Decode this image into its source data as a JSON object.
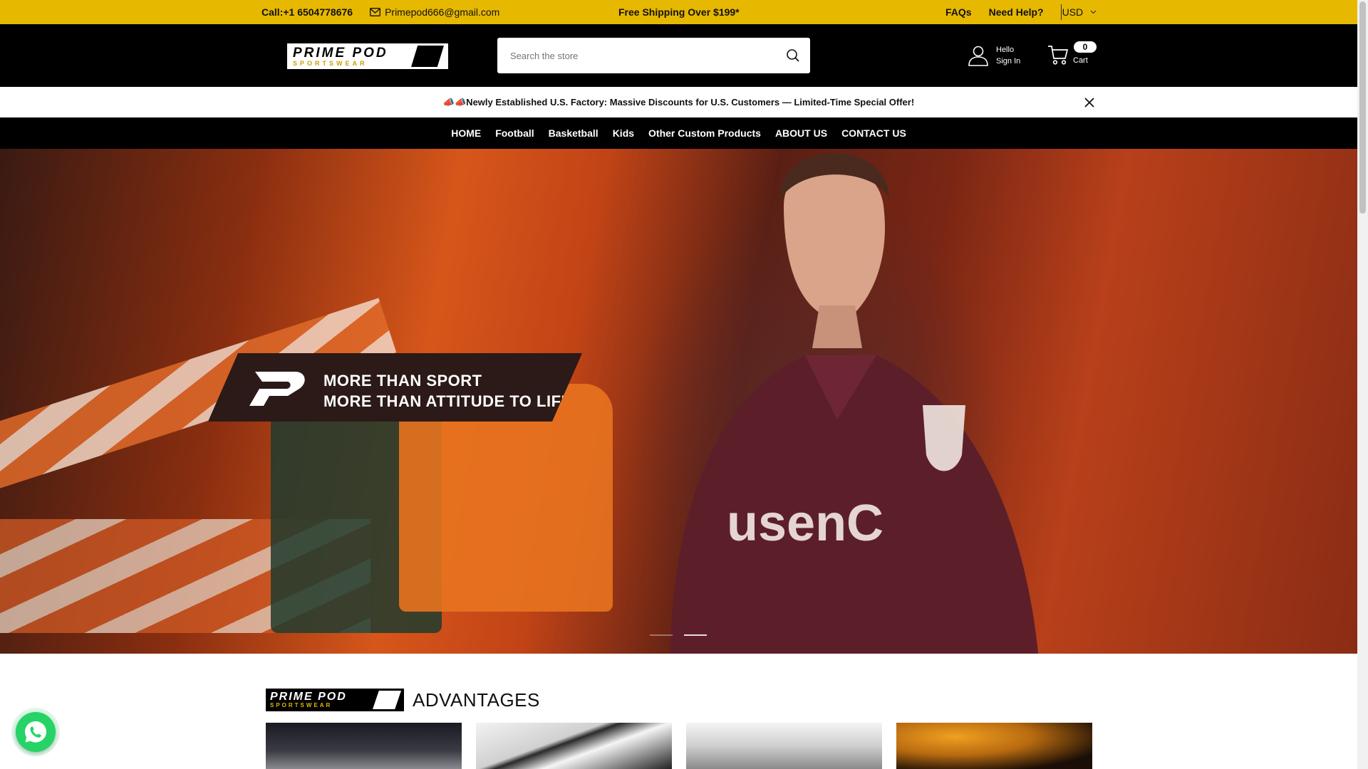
{
  "topbar": {
    "call": "Call:+1 6504778676",
    "email": "Primepod666@gmail.com",
    "shipping": "Free Shipping Over $199*",
    "faqs": "FAQs",
    "help": "Need Help?",
    "currency": "USD"
  },
  "header": {
    "logo_line1": "PRIME POD",
    "logo_line2": "SPORTSWEAR",
    "search_placeholder": "Search the store",
    "account_hello": "Hello",
    "account_signin": "Sign In",
    "cart_count": "0",
    "cart_label": "Cart"
  },
  "announcement": {
    "text": "📣📣Newly Established U.S. Factory: Massive Discounts for U.S. Customers — Limited-Time Special Offer!"
  },
  "nav": {
    "items": [
      "HOME",
      "Football",
      "Basketball",
      "Kids",
      "Other Custom Products",
      "ABOUT US",
      "CONTACT US"
    ]
  },
  "hero": {
    "tag_line1": "MORE THAN SPORT",
    "tag_line2": "MORE THAN ATTITUDE TO LIFE",
    "slides_total": 2,
    "active_slide": 2
  },
  "advantages": {
    "logo_line1": "PRIME POD",
    "logo_line2": "SPORTSWEAR",
    "title": "ADVANTAGES"
  },
  "colors": {
    "topbar_bg": "#e6b800",
    "header_bg": "#000000",
    "whatsapp": "#25d366"
  },
  "icons": [
    "mail-icon",
    "chevron-down-icon",
    "search-icon",
    "user-icon",
    "cart-icon",
    "close-icon",
    "whatsapp-icon"
  ]
}
